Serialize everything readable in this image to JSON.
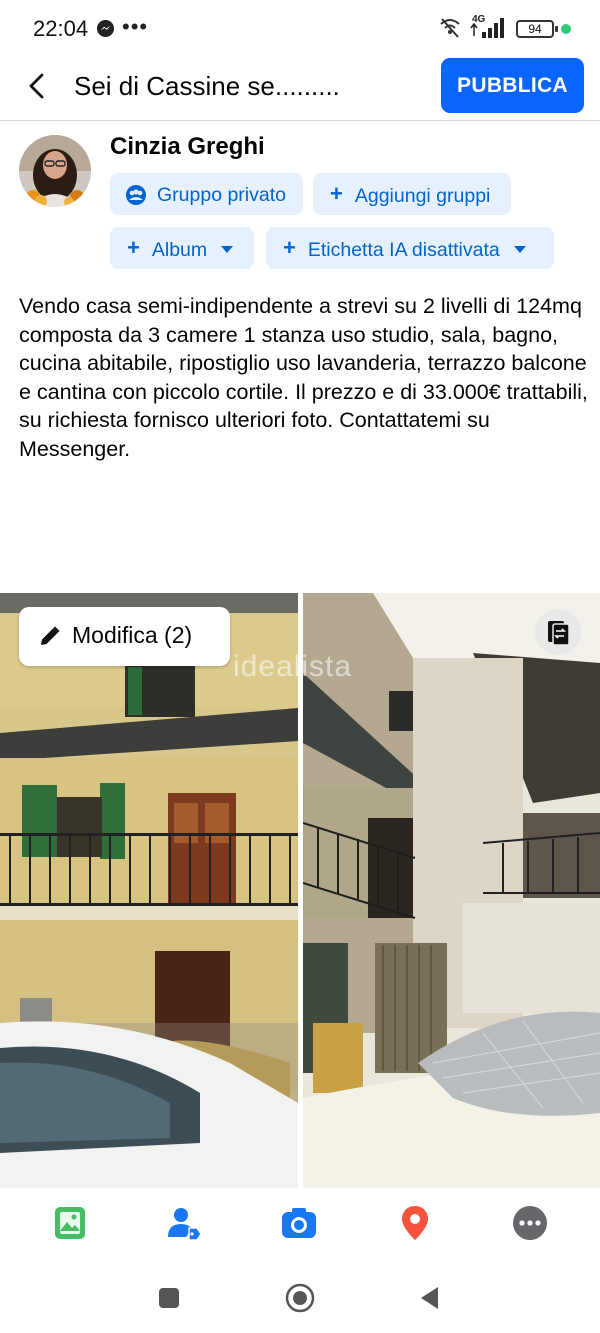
{
  "status_bar": {
    "time": "22:04",
    "network": "4G",
    "battery": "94"
  },
  "header": {
    "title": "Sei di Cassine se.........",
    "publish_label": "PUBBLICA"
  },
  "author": {
    "name": "Cinzia Greghi"
  },
  "chips": {
    "privacy": "Gruppo privato",
    "add_groups": "Aggiungi gruppi",
    "album": "Album",
    "ai_label": "Etichetta IA disattivata"
  },
  "post": {
    "text": "Vendo casa semi-indipendente a strevi su 2 livelli di 124mq composta da 3 camere 1 stanza uso studio, sala, bagno, cucina abitabile, ripostiglio uso lavanderia,  terrazzo balcone e cantina con piccolo cortile. Il prezzo e di 33.000€ trattabili, su richiesta fornisco ulteriori foto. Contattatemi su Messenger."
  },
  "photos": {
    "edit_label": "Modifica (2)",
    "watermark": "idealista"
  },
  "toolbar": {
    "icons": [
      "photo-icon",
      "tag-people-icon",
      "camera-icon",
      "location-icon",
      "more-icon"
    ],
    "colors": {
      "photo": "#45bd62",
      "tag": "#1877f2",
      "camera": "#1877f2",
      "location": "#f5533d",
      "more": "#65676b"
    }
  },
  "accent_color": "#0866ff"
}
